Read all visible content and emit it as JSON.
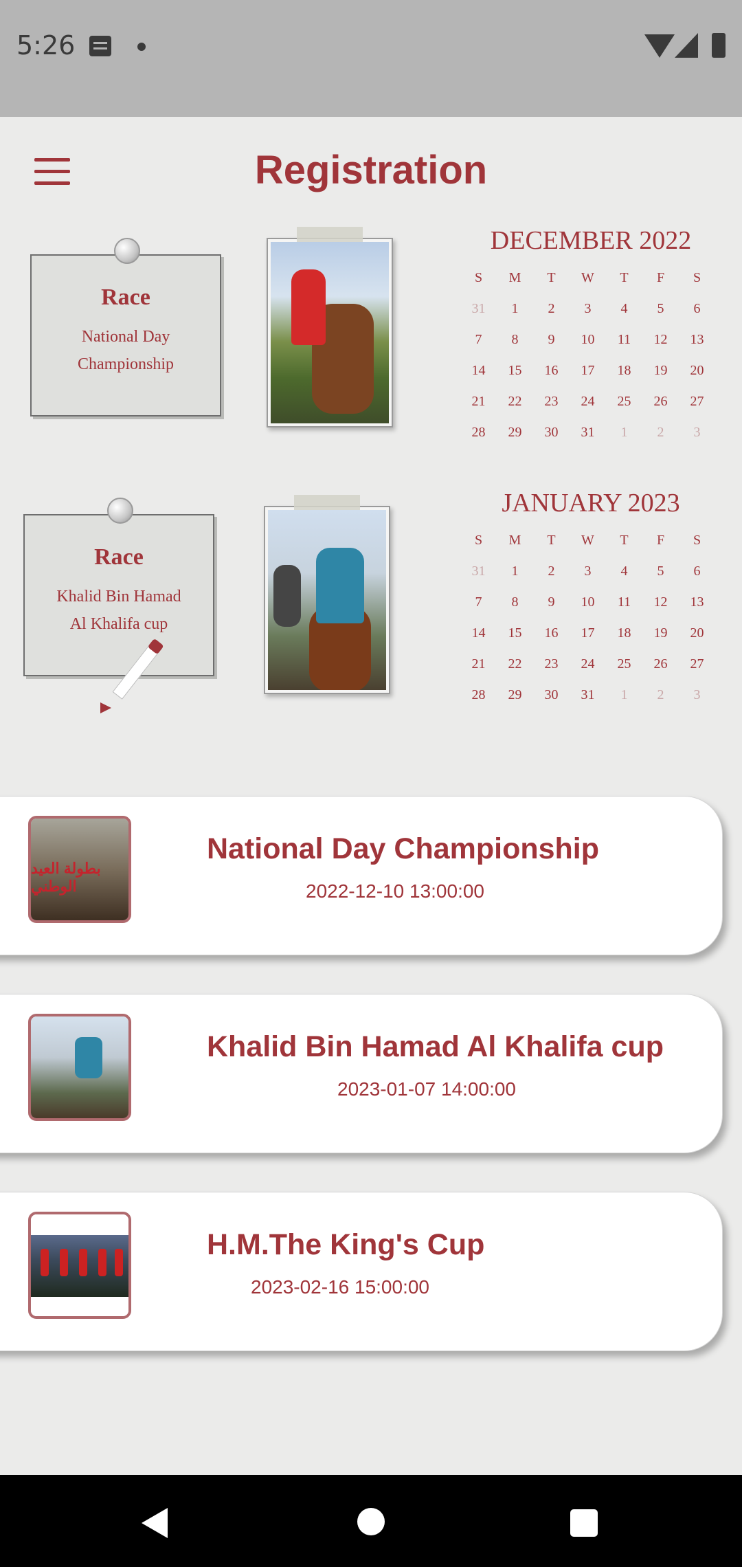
{
  "status_bar": {
    "time": "5:26"
  },
  "header": {
    "title": "Registration"
  },
  "notes": [
    {
      "heading": "Race",
      "line1": "National Day",
      "line2": "Championship"
    },
    {
      "heading": "Race",
      "line1": "Khalid Bin Hamad",
      "line2": "Al Khalifa cup"
    }
  ],
  "calendars": [
    {
      "month": "DECEMBER 2022",
      "dow": [
        "S",
        "M",
        "T",
        "W",
        "T",
        "F",
        "S"
      ],
      "days": [
        "31",
        "1",
        "2",
        "3",
        "4",
        "5",
        "6",
        "7",
        "8",
        "9",
        "10",
        "11",
        "12",
        "13",
        "14",
        "15",
        "16",
        "17",
        "18",
        "19",
        "20",
        "21",
        "22",
        "23",
        "24",
        "25",
        "26",
        "27",
        "28",
        "29",
        "30",
        "31",
        "1",
        "2",
        "3"
      ],
      "muted_indices": [
        0,
        32,
        33,
        34
      ],
      "highlighted_indices": [
        9,
        10
      ]
    },
    {
      "month": "JANUARY 2023",
      "dow": [
        "S",
        "M",
        "T",
        "W",
        "T",
        "F",
        "S"
      ],
      "days": [
        "31",
        "1",
        "2",
        "3",
        "4",
        "5",
        "6",
        "7",
        "8",
        "9",
        "10",
        "11",
        "12",
        "13",
        "14",
        "15",
        "16",
        "17",
        "18",
        "19",
        "20",
        "21",
        "22",
        "23",
        "24",
        "25",
        "26",
        "27",
        "28",
        "29",
        "30",
        "31",
        "1",
        "2",
        "3"
      ],
      "muted_indices": [
        0,
        32,
        33,
        34
      ],
      "highlighted_indices": [
        6,
        7
      ]
    }
  ],
  "thumb_text": "بطولة العيد الوطني",
  "races": [
    {
      "name": "National Day Championship",
      "datetime": "2022-12-10 13:00:00"
    },
    {
      "name": "Khalid Bin Hamad Al Khalifa cup",
      "datetime": "2023-01-07 14:00:00"
    },
    {
      "name": "H.M.The King's Cup",
      "datetime": "2023-02-16 15:00:00"
    }
  ],
  "colors": {
    "accent": "#a0353a",
    "background": "#ebebea",
    "card": "#ffffff",
    "highlight": "#faf7dc"
  },
  "icons": [
    "menu-icon",
    "notification-icon",
    "wifi-icon",
    "signal-icon",
    "battery-icon",
    "back-icon",
    "home-icon",
    "recents-icon"
  ]
}
